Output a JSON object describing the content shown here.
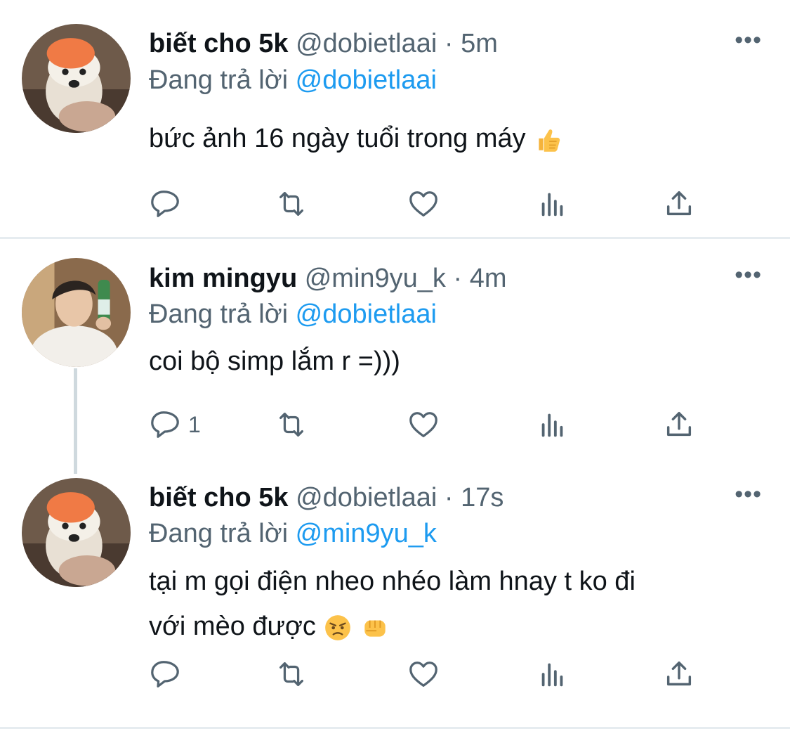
{
  "tweets": [
    {
      "name": "biết cho 5k",
      "handle": "@dobietlaai",
      "time": "· 5m",
      "replying_prefix": "Đang trả lời",
      "replying_to": "@dobietlaai",
      "text_lines": [
        "bức ảnh 16 ngày tuổi trong máy"
      ],
      "emoji": [
        "thumbs-up"
      ],
      "reply_count": ""
    },
    {
      "name": "kim mingyu",
      "handle": "@min9yu_k",
      "time": "· 4m",
      "replying_prefix": "Đang trả lời",
      "replying_to": "@dobietlaai",
      "text_lines": [
        "coi bộ simp lắm r =)))"
      ],
      "emoji": [],
      "reply_count": "1"
    },
    {
      "name": "biết cho 5k",
      "handle": "@dobietlaai",
      "time": "· 17s",
      "replying_prefix": "Đang trả lời",
      "replying_to": "@min9yu_k",
      "text_lines": [
        "tại m gọi điện nheo nhéo làm hnay t ko đi",
        "với mèo được"
      ],
      "emoji": [
        "angry-face",
        "fist"
      ],
      "reply_count": ""
    }
  ],
  "more_label": "•••",
  "colors": {
    "link": "#1d9bf0",
    "muted": "#536471",
    "text": "#0f1419",
    "divider": "#e6ecf0",
    "thread": "#cfd9de"
  }
}
